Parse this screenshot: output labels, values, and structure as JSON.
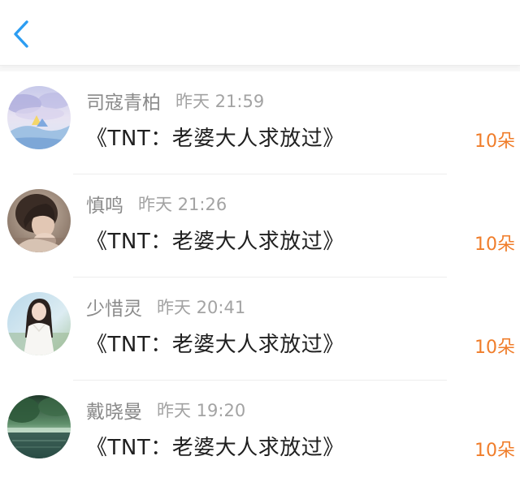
{
  "header": {
    "back_icon": "chevron-left-icon"
  },
  "colors": {
    "accent_blue": "#2c9df2",
    "count_orange": "#f07d2a",
    "name_gray": "#8a8a8a"
  },
  "gifts": [
    {
      "user": "司寇青柏",
      "time": "昨天 21:59",
      "book": "《TNT：老婆大人求放过》",
      "count": "10朵",
      "avatar": "watercolor-landscape-avatar"
    },
    {
      "user": "慎鸣",
      "time": "昨天 21:26",
      "book": "《TNT：老婆大人求放过》",
      "count": "10朵",
      "avatar": "girl-portrait-avatar"
    },
    {
      "user": "少惜灵",
      "time": "昨天 20:41",
      "book": "《TNT：老婆大人求放过》",
      "count": "10朵",
      "avatar": "girl-white-dress-avatar"
    },
    {
      "user": "戴晓曼",
      "time": "昨天 19:20",
      "book": "《TNT：老婆大人求放过》",
      "count": "10朵",
      "avatar": "green-lake-avatar"
    }
  ]
}
